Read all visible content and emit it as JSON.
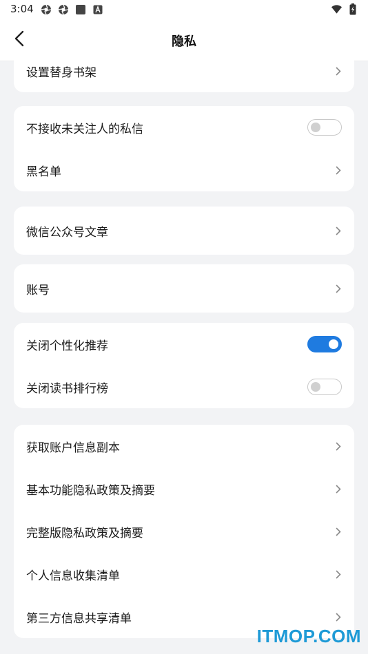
{
  "status_bar": {
    "time": "3:04",
    "left_icons": [
      "aperture-icon",
      "aperture-icon",
      "square-icon",
      "a-badge-icon"
    ],
    "right_icons": [
      "wifi-icon",
      "battery-charging-icon"
    ]
  },
  "header": {
    "title": "隐私",
    "back_icon": "chevron-left-icon"
  },
  "groups": [
    {
      "items": [
        {
          "label": "设置替身书架",
          "control": "chevron"
        }
      ]
    },
    {
      "items": [
        {
          "label": "不接收未关注人的私信",
          "control": "toggle",
          "on": false
        },
        {
          "label": "黑名单",
          "control": "chevron"
        }
      ]
    },
    {
      "items": [
        {
          "label": "微信公众号文章",
          "control": "chevron"
        }
      ]
    },
    {
      "items": [
        {
          "label": "账号",
          "control": "chevron"
        }
      ]
    },
    {
      "items": [
        {
          "label": "关闭个性化推荐",
          "control": "toggle",
          "on": true
        },
        {
          "label": "关闭读书排行榜",
          "control": "toggle",
          "on": false
        }
      ]
    },
    {
      "items": [
        {
          "label": "获取账户信息副本",
          "control": "chevron"
        },
        {
          "label": "基本功能隐私政策及摘要",
          "control": "chevron"
        },
        {
          "label": "完整版隐私政策及摘要",
          "control": "chevron"
        },
        {
          "label": "个人信息收集清单",
          "control": "chevron"
        },
        {
          "label": "第三方信息共享清单",
          "control": "chevron"
        }
      ]
    }
  ],
  "watermark": "ITMOP.COM",
  "colors": {
    "accent": "#1f7be0",
    "background": "#f2f3f5",
    "card": "#ffffff",
    "watermark": "#1e9ad6"
  }
}
